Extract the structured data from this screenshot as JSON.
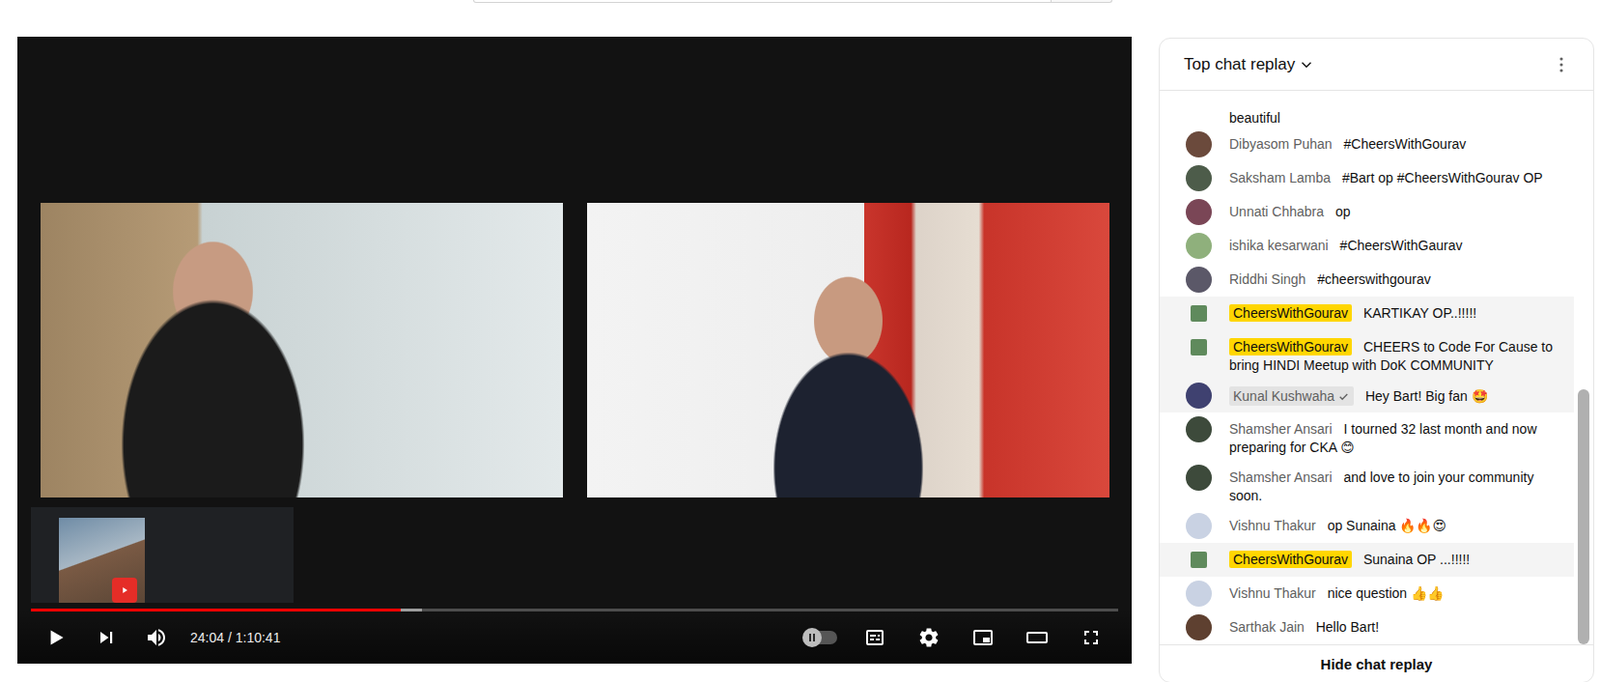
{
  "player": {
    "time": "24:04 / 1:10:41",
    "progress": 0.34,
    "buffered": 0.36,
    "playing": false,
    "autoplay": false,
    "captions": false,
    "muted": false
  },
  "chat": {
    "title": "Top chat replay",
    "scroll": {
      "level": 1
    },
    "messages": [
      {
        "kind": "continuation",
        "text": "beautiful"
      },
      {
        "kind": "message",
        "author": "Dibyasom Puhan",
        "role": "viewer",
        "highlighted": false,
        "color": "#6b4a3c",
        "text": "#CheersWithGourav"
      },
      {
        "kind": "message",
        "author": "Saksham Lamba",
        "role": "viewer",
        "highlighted": false,
        "color": "#4d5c4a",
        "text": "#Bart op #CheersWithGourav OP"
      },
      {
        "kind": "message",
        "author": "Unnati Chhabra",
        "role": "viewer",
        "highlighted": false,
        "color": "#7a4656",
        "text": "op"
      },
      {
        "kind": "message",
        "author": "ishika kesarwani",
        "role": "viewer",
        "highlighted": false,
        "color": "#8fb07c",
        "text": "#CheersWithGaurav"
      },
      {
        "kind": "message",
        "author": "Riddhi Singh",
        "role": "viewer",
        "highlighted": false,
        "color": "#5b5868",
        "text": "#cheerswithgourav"
      },
      {
        "kind": "message",
        "author": "CheersWithGourav",
        "role": "owner",
        "highlighted": true,
        "color": "#5f8a5c",
        "text": "KARTIKAY OP..!!!!!"
      },
      {
        "kind": "message",
        "author": "CheersWithGourav",
        "role": "owner",
        "highlighted": true,
        "color": "#5f8a5c",
        "text": "CHEERS to Code For Cause to bring HINDI Meetup with DoK COMMUNITY"
      },
      {
        "kind": "message",
        "author": "Kunal Kushwaha",
        "role": "verified",
        "highlighted": true,
        "color": "#3f4170",
        "text": "Hey Bart! Big fan 🤩"
      },
      {
        "kind": "message",
        "author": "Shamsher Ansari",
        "role": "viewer",
        "highlighted": false,
        "color": "#3d4a3b",
        "text": "I tourned 32 last month and now preparing for CKA 😊"
      },
      {
        "kind": "message",
        "author": "Shamsher Ansari",
        "role": "viewer",
        "highlighted": false,
        "color": "#3d4a3b",
        "text": "and love to join your community soon."
      },
      {
        "kind": "message",
        "author": "Vishnu Thakur",
        "role": "viewer",
        "highlighted": false,
        "color": "#c9d2e3",
        "text": "op Sunaina 🔥🔥😍"
      },
      {
        "kind": "message",
        "author": "CheersWithGourav",
        "role": "owner",
        "highlighted": true,
        "color": "#5f8a5c",
        "text": "Sunaina OP ...!!!!!"
      },
      {
        "kind": "message",
        "author": "Vishnu Thakur",
        "role": "viewer",
        "highlighted": false,
        "color": "#c9d2e3",
        "text": "nice question 👍👍"
      },
      {
        "kind": "message",
        "author": "Sarthak Jain",
        "role": "viewer",
        "highlighted": false,
        "color": "#5e4030",
        "text": "Hello Bart!"
      }
    ],
    "footer_button": "Hide chat replay"
  }
}
